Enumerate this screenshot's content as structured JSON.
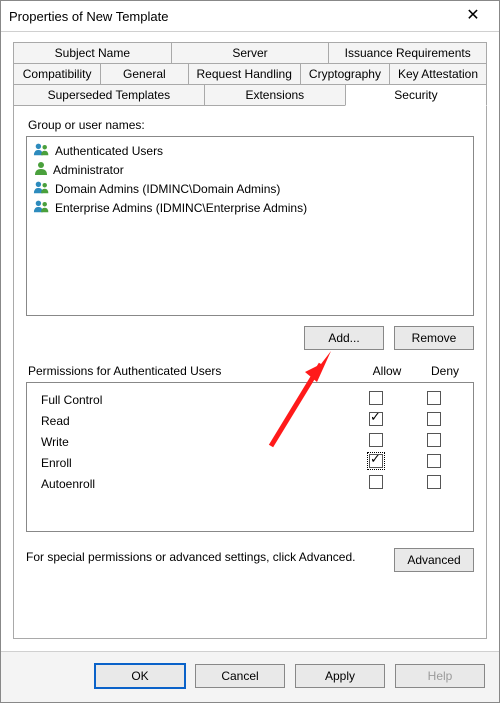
{
  "window": {
    "title": "Properties of New Template"
  },
  "tabs_row1": [
    {
      "label": "Subject Name"
    },
    {
      "label": "Server"
    },
    {
      "label": "Issuance Requirements"
    }
  ],
  "tabs_row2": [
    {
      "label": "Compatibility"
    },
    {
      "label": "General"
    },
    {
      "label": "Request Handling"
    },
    {
      "label": "Cryptography"
    },
    {
      "label": "Key Attestation"
    }
  ],
  "tabs_row3": [
    {
      "label": "Superseded Templates"
    },
    {
      "label": "Extensions"
    },
    {
      "label": "Security"
    }
  ],
  "active_tab": "Security",
  "group_label": "Group or user names:",
  "principals": [
    {
      "name": "Authenticated Users",
      "type": "group"
    },
    {
      "name": "Administrator",
      "type": "user"
    },
    {
      "name": "Domain Admins (IDMINC\\Domain Admins)",
      "type": "group"
    },
    {
      "name": "Enterprise Admins (IDMINC\\Enterprise Admins)",
      "type": "group"
    }
  ],
  "buttons": {
    "add": "Add...",
    "remove": "Remove",
    "advanced": "Advanced",
    "ok": "OK",
    "cancel": "Cancel",
    "apply": "Apply",
    "help": "Help"
  },
  "perm_header": {
    "title": "Permissions for Authenticated Users",
    "allow": "Allow",
    "deny": "Deny"
  },
  "permissions": [
    {
      "name": "Full Control",
      "allow": false,
      "deny": false,
      "focus": false
    },
    {
      "name": "Read",
      "allow": true,
      "deny": false,
      "focus": false
    },
    {
      "name": "Write",
      "allow": false,
      "deny": false,
      "focus": false
    },
    {
      "name": "Enroll",
      "allow": true,
      "deny": false,
      "focus": true
    },
    {
      "name": "Autoenroll",
      "allow": false,
      "deny": false,
      "focus": false
    }
  ],
  "special_text": "For special permissions or advanced settings, click Advanced."
}
